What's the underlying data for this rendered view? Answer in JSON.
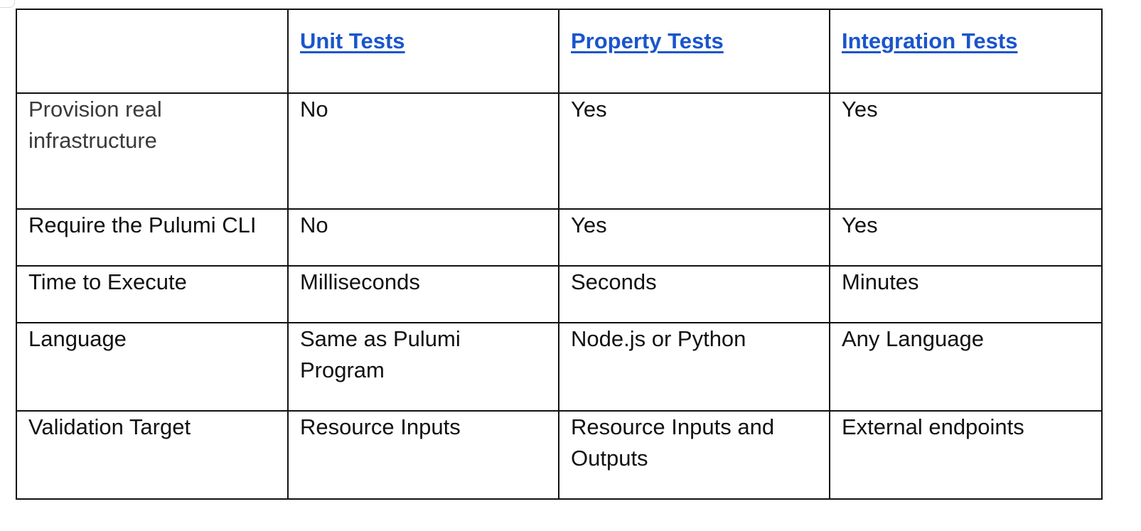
{
  "table": {
    "columns": [
      {
        "label": ""
      },
      {
        "label": "Unit Tests"
      },
      {
        "label": "Property Tests"
      },
      {
        "label": "Integration Tests"
      }
    ],
    "rows": [
      {
        "label": "Provision real infrastructure",
        "unit": "No",
        "property": "Yes",
        "integration": "Yes"
      },
      {
        "label": "Require the Pulumi CLI",
        "unit": "No",
        "property": "Yes",
        "integration": "Yes"
      },
      {
        "label": "Time to Execute",
        "unit": "Milliseconds",
        "property": "Seconds",
        "integration": "Minutes"
      },
      {
        "label": "Language",
        "unit": "Same as Pulumi Program",
        "property": "Node.js or Python",
        "integration": "Any Language"
      },
      {
        "label": "Validation Target",
        "unit": "Resource Inputs",
        "property": "Resource Inputs and Outputs",
        "integration": "External endpoints"
      }
    ]
  },
  "colors": {
    "link": "#1a55cc",
    "border": "#111111",
    "text": "#111111"
  }
}
